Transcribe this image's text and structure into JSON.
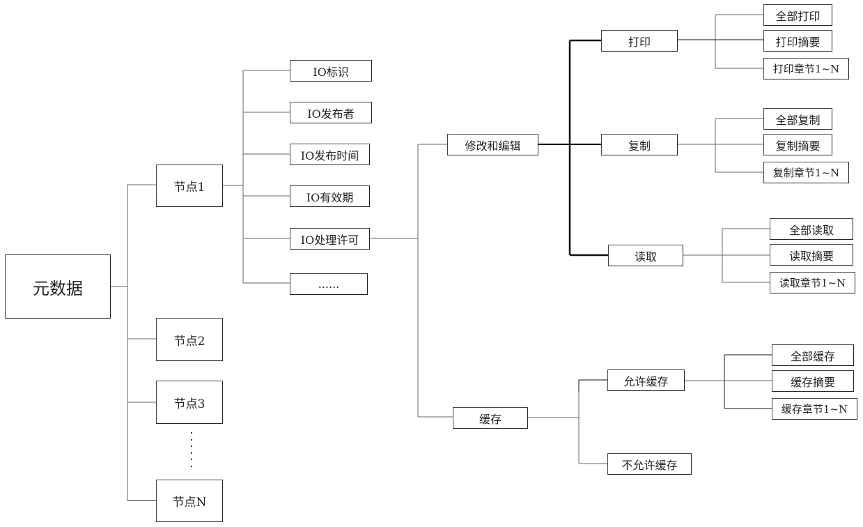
{
  "root": {
    "label": "元数据"
  },
  "nodes": [
    {
      "label": "节点1"
    },
    {
      "label": "节点2"
    },
    {
      "label": "节点3"
    },
    {
      "label": "节点N"
    }
  ],
  "node_ellipsis": "⋮",
  "node1_children": [
    {
      "label": "IO标识"
    },
    {
      "label": "IO发布者"
    },
    {
      "label": "IO发布时间"
    },
    {
      "label": "IO有效期"
    },
    {
      "label": "IO处理许可"
    },
    {
      "label": "......"
    }
  ],
  "permissions": {
    "edit": {
      "label": "修改和编辑",
      "groups": [
        {
          "label": "打印",
          "children": [
            {
              "label": "全部打印"
            },
            {
              "label": "打印摘要"
            },
            {
              "label": "打印章节1~N"
            }
          ]
        },
        {
          "label": "复制",
          "children": [
            {
              "label": "全部复制"
            },
            {
              "label": "复制摘要"
            },
            {
              "label": "复制章节1~N"
            }
          ]
        },
        {
          "label": "读取",
          "children": [
            {
              "label": "全部读取"
            },
            {
              "label": "读取摘要"
            },
            {
              "label": "读取章节1~N"
            }
          ]
        }
      ]
    },
    "cache": {
      "label": "缓存",
      "groups": [
        {
          "label": "允许缓存",
          "children": [
            {
              "label": "全部缓存"
            },
            {
              "label": "缓存摘要"
            },
            {
              "label": "缓存章节1~N"
            }
          ]
        },
        {
          "label": "不允许缓存",
          "children": []
        }
      ]
    }
  }
}
